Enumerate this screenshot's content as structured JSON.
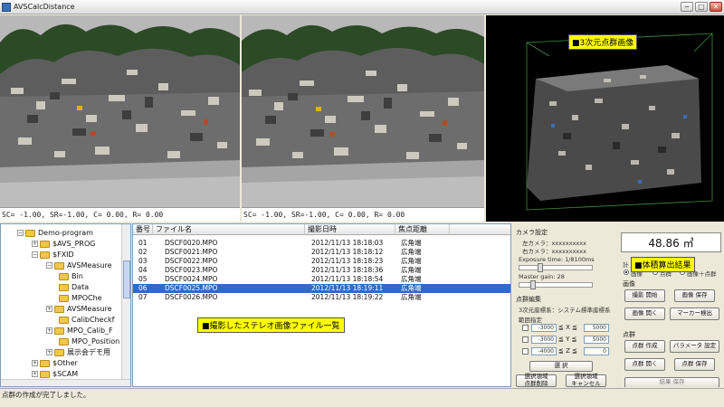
{
  "window": {
    "title": "AVSCalcDistance",
    "min": "─",
    "max": "□",
    "close": "✕"
  },
  "views": {
    "left_coords": "SC= -1.00, SR=-1.00, C= 0.00, R= 0.00",
    "right_coords": "SC= -1.00, SR=-1.00, C= 0.00, R= 0.00",
    "pointcloud_label": "■3次元点群画像"
  },
  "tree": {
    "items": [
      {
        "label": "Demo-program",
        "exp": "−"
      },
      {
        "label": "$AVS_PROG",
        "exp": "+"
      },
      {
        "label": "$FXID",
        "exp": "−"
      },
      {
        "label": "AVSMeasure",
        "exp": "−"
      },
      {
        "label": "Bin",
        "exp": ""
      },
      {
        "label": "Data",
        "exp": ""
      },
      {
        "label": "MPOChe",
        "exp": ""
      },
      {
        "label": "AVSMeasure",
        "exp": "+"
      },
      {
        "label": "CalibCheckf",
        "exp": ""
      },
      {
        "label": "MPO_Calib_F",
        "exp": "+"
      },
      {
        "label": "MPO_Position",
        "exp": ""
      },
      {
        "label": "展示会デモ用",
        "exp": "+"
      },
      {
        "label": "$Other",
        "exp": "+"
      },
      {
        "label": "$SCAM",
        "exp": "+"
      }
    ]
  },
  "files": {
    "headers": [
      "番号",
      "ファイル名",
      "撮影日時",
      "焦点距離"
    ],
    "rows": [
      [
        "01",
        "DSCF0020.MPO",
        "2012/11/13 18:18:03",
        "広角端"
      ],
      [
        "02",
        "DSCF0021.MPO",
        "2012/11/13 18:18:12",
        "広角端"
      ],
      [
        "03",
        "DSCF0022.MPO",
        "2012/11/13 18:18:23",
        "広角端"
      ],
      [
        "04",
        "DSCF0023.MPO",
        "2012/11/13 18:18:36",
        "広角端"
      ],
      [
        "05",
        "DSCF0024.MPO",
        "2012/11/13 18:18:54",
        "広角端"
      ],
      [
        "06",
        "DSCF0025.MPO",
        "2012/11/13 18:19:11",
        "広角端"
      ],
      [
        "07",
        "DSCF0026.MPO",
        "2012/11/13 18:19:22",
        "広角端"
      ]
    ],
    "selected_index": 5,
    "overlay_label": "■撮影したステレオ画像ファイル一覧"
  },
  "settings": {
    "camera_heading": "カメラ設定",
    "left_camera": "左カメラ：xxxxxxxxxx",
    "right_camera": "右カメラ：xxxxxxxxxx",
    "exposure": "Exposure time: 1/8100ms",
    "gain": "Master gain: 28",
    "pc_edit": "点群編集",
    "coord_system": "3次元座標系：システム標準座標系",
    "range": "範囲指定",
    "x_min": "-3000",
    "x_max": "5000",
    "y_min": "-3000",
    "y_max": "5000",
    "z_min": "-4000",
    "z_max": "0",
    "x_op": "≦ X ≦",
    "y_op": "≦ Y ≦",
    "z_op": "≦ Z ≦",
    "select_btn": "選 択",
    "delete_btn": "選択領域\n点群削除",
    "cancel_btn": "選択領域\nキャンセル"
  },
  "results": {
    "volume": "48.86 ㎥",
    "label": "■体積算出結果",
    "calc_prefix": "計",
    "radio1": "画像",
    "radio2": "点群",
    "radio3": "画像＋点群",
    "image_heading": "画像",
    "capture_start": "撮影 開始",
    "image_save": "画像 保存",
    "image_open": "画像 開く",
    "marker_detect": "マーカー検出",
    "pc_heading": "点群",
    "pc_create": "点群 作成",
    "param_set": "パラメータ 設定",
    "pc_open": "点群 開く",
    "pc_save": "点群 保存",
    "result_save": "結果 保存"
  },
  "status": {
    "text": "点群の作成が完了しました。"
  }
}
